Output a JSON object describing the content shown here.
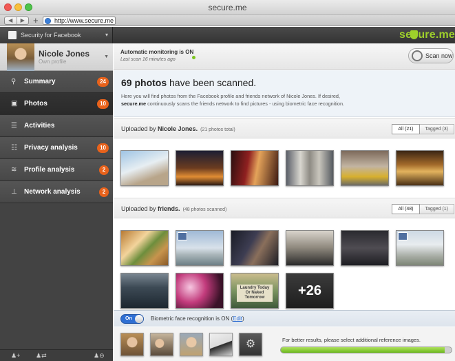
{
  "window": {
    "title": "secure.me",
    "url": "http://www.secure.me"
  },
  "header": {
    "selector_label": "Security for Facebook",
    "brand": "secure.me"
  },
  "profile": {
    "name": "Nicole Jones",
    "subtitle": "Own profile"
  },
  "sidebar": {
    "items": [
      {
        "label": "Summary",
        "icon": "search-icon",
        "badge": "24",
        "active": false
      },
      {
        "label": "Photos",
        "icon": "photo-icon",
        "badge": "10",
        "active": true
      },
      {
        "label": "Activities",
        "icon": "list-icon",
        "badge": "",
        "active": false
      },
      {
        "label": "Privacy analysis",
        "icon": "privacy-icon",
        "badge": "10",
        "active": false
      },
      {
        "label": "Profile analysis",
        "icon": "profile-icon",
        "badge": "2",
        "active": false
      },
      {
        "label": "Network analysis",
        "icon": "network-icon",
        "badge": "2",
        "active": false
      }
    ]
  },
  "monitor": {
    "status": "Automatic monitoring is ON",
    "last_scan": "Last scan 16 minutes ago",
    "scan_button": "Scan now"
  },
  "headline": {
    "count": "69 photos",
    "title_rest": " have been scanned.",
    "desc_part1": "Here you will find photos from the Facebook profile and friends network of Nicole Jones. If desired,",
    "desc_brand": "secure.me",
    "desc_part2": " continuously scans the friends network to find pictures - using biometric face recognition."
  },
  "own_section": {
    "prefix": "Uploaded by ",
    "owner": "Nicole Jones.",
    "count": "(21 photos total)",
    "tab_all": "All (21)",
    "tab_tagged": "Tagged (3)"
  },
  "friends_section": {
    "prefix": "Uploaded by ",
    "owner": "friends.",
    "count": "(48 photos scanned)",
    "tab_all": "All (48)",
    "tab_tagged": "Tagged (1)",
    "more_label": "+26",
    "sign_text": "Laundry Today Or Naked Tomorrow"
  },
  "bio": {
    "toggle_label": "On",
    "text": "Biometric face recognition is ON (",
    "edit_link": "Edit",
    "text_end": ")"
  },
  "reference": {
    "hint": "For better results, please select additional reference images.",
    "progress_fraction": 0.96
  },
  "colors": {
    "accent": "#9ed02b",
    "badge": "#e8621b",
    "link": "#2f6fd3"
  }
}
